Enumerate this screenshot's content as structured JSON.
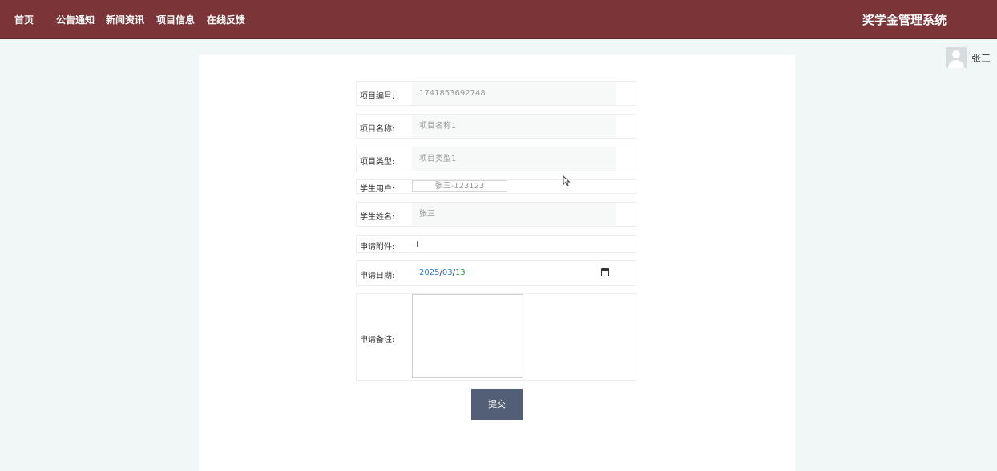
{
  "header": {
    "nav": [
      "首页",
      "公告通知",
      "新闻资讯",
      "项目信息",
      "在线反馈"
    ],
    "title": "奖学金管理系统"
  },
  "user": {
    "name": "张三"
  },
  "form": {
    "project_no": {
      "label": "项目编号:",
      "value": "1741853692748"
    },
    "project_name": {
      "label": "项目名称:",
      "value": "项目名称1"
    },
    "project_type": {
      "label": "项目类型:",
      "value": "项目类型1"
    },
    "student_user": {
      "label": "学生用户:",
      "value": "张三-123123"
    },
    "student_name": {
      "label": "学生姓名:",
      "value": "张三"
    },
    "attachment": {
      "label": "申请附件:",
      "value": "+"
    },
    "apply_date": {
      "label": "申请日期:",
      "year": "2025",
      "month": "03",
      "day": "13",
      "sep": "/"
    },
    "remark": {
      "label": "申请备注:",
      "value": ""
    },
    "submit": "提交"
  }
}
